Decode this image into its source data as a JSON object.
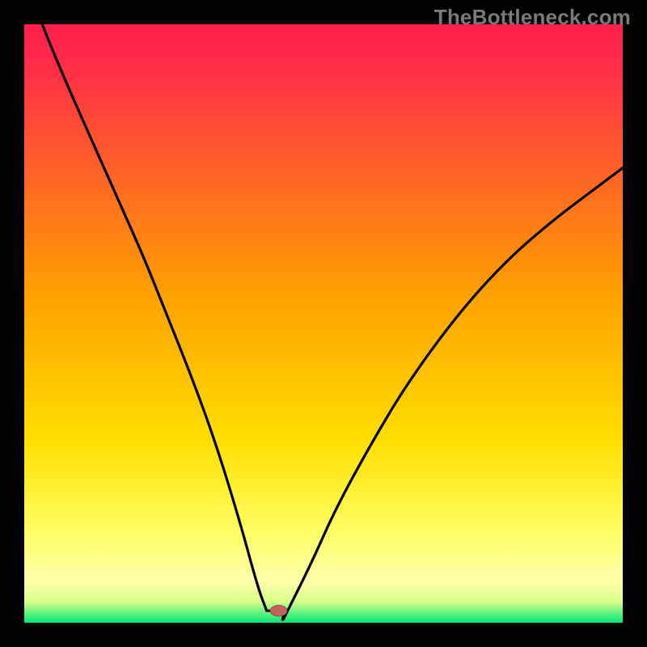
{
  "watermark": "TheBottleneck.com",
  "colors": {
    "frame_bg": "#000000",
    "watermark": "#7a7a7a",
    "gradient_top": "#ff1f4b",
    "gradient_mid": "#ffd400",
    "gradient_lowlight": "#ffff99",
    "gradient_bottom": "#00e676",
    "curve": "#000000",
    "marker_fill": "#c1635a",
    "marker_stroke": "#9e4a43"
  },
  "chart_data": {
    "type": "line",
    "title": "",
    "xlabel": "",
    "ylabel": "",
    "xlim": [
      0,
      100
    ],
    "ylim": [
      0,
      100
    ],
    "grid": false,
    "legend": false,
    "x": [
      3,
      5,
      8,
      12,
      16,
      20,
      24,
      28,
      32,
      36,
      39,
      40.5,
      42,
      43,
      44,
      48,
      52,
      58,
      64,
      72,
      80,
      88,
      96,
      100
    ],
    "y": [
      100,
      95,
      88,
      79,
      70,
      61,
      51,
      41,
      30,
      17,
      6,
      2,
      0,
      0,
      2,
      10,
      19,
      30,
      40,
      51,
      60,
      67,
      73,
      76
    ],
    "flat_bottom": {
      "x_start": 40.5,
      "x_end": 43.5,
      "y": 2
    },
    "marker": {
      "x": 42.5,
      "y": 2,
      "rx": 1.4,
      "ry": 0.9
    },
    "gradient_stops": [
      {
        "offset": 0.0,
        "color": "#ff1f4b"
      },
      {
        "offset": 0.06,
        "color": "#ff2a4a"
      },
      {
        "offset": 0.45,
        "color": "#ffa000"
      },
      {
        "offset": 0.7,
        "color": "#ffe000"
      },
      {
        "offset": 0.85,
        "color": "#ffff66"
      },
      {
        "offset": 0.93,
        "color": "#ffffaa"
      },
      {
        "offset": 0.965,
        "color": "#d8ff88"
      },
      {
        "offset": 1.0,
        "color": "#00e676"
      }
    ]
  }
}
